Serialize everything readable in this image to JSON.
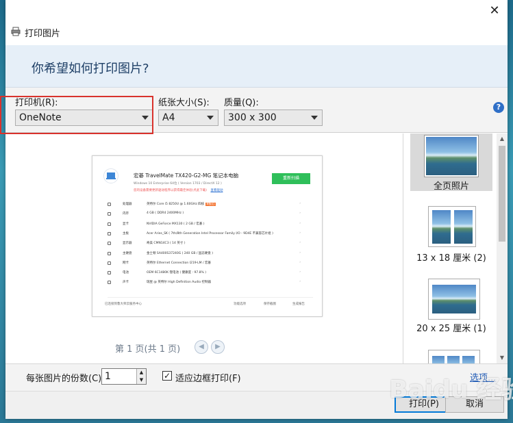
{
  "window": {
    "title": "打印图片",
    "close_glyph": "✕"
  },
  "banner": {
    "question": "你希望如何打印图片?"
  },
  "options": {
    "printer_label": "打印机(R):",
    "printer_value": "OneNote",
    "paper_label": "纸张大小(S):",
    "paper_value": "A4",
    "quality_label": "质量(Q):",
    "quality_value": "300 x 300",
    "help_glyph": "?"
  },
  "preview": {
    "page_info": "第 1 页(共 1 页)",
    "prev_glyph": "◀",
    "next_glyph": "▶",
    "document": {
      "title": "宏碁 TravelMate TX420-G2-MG 笔记本电脑",
      "subtitle": "Windows 10 Enterprise 64位 ( Version 1703 / DirectX 12 )",
      "warning": "您的设备需要更新驱动程序以获得最佳体验(点此下载)",
      "warning_link": "查看驱动",
      "scan_button": "重新扫描",
      "rows": [
        {
          "key": "处理器",
          "value": "英特尔 Core i5 8250U @ 1.60GHz 四核",
          "tag": "8核心"
        },
        {
          "key": "内存",
          "value": "4 GB ( DDR4 2400MHz )"
        },
        {
          "key": "显卡",
          "value": "NVIDIA GeForce MX130 ( 2 GB / 宏碁 )"
        },
        {
          "key": "主板",
          "value": "Acer Aries_SK ( 7th/8th Generation Intel Processor Family I/O - 9D4E 不兼容芯片组 )"
        },
        {
          "key": "显示器",
          "value": "奇美 CMN14C3 ( 14 英寸 )"
        },
        {
          "key": "主硬盘",
          "value": "金士顿 SA400S37240G ( 240 GB / 固态硬盘 )"
        },
        {
          "key": "网卡",
          "value": "英特尔 Ethernet Connection I219-LM / 宏碁"
        },
        {
          "key": "电池",
          "value": "OEM 6C1480K 锂电池 ( 健康度 : 97.8% )"
        },
        {
          "key": "声卡",
          "value": "瑞昱 @ 英特尔 High Definition Audio 控制器"
        }
      ],
      "footer_left": "已连接到鲁大师云服务中心",
      "footer_a": "功能选项",
      "footer_b": "保存截图",
      "footer_c": "生成报告"
    }
  },
  "layouts": [
    {
      "caption": "全页照片",
      "selected": true
    },
    {
      "caption": "13 x 18 厘米 (2)",
      "selected": false
    },
    {
      "caption": "20 x 25 厘米 (1)",
      "selected": false
    },
    {
      "caption": "",
      "selected": false
    }
  ],
  "copies": {
    "label": "每张图片的份数(C):",
    "value": "1"
  },
  "fit": {
    "label": "适应边框打印(F)",
    "checked": true,
    "check_glyph": "✓"
  },
  "options_link": "选项...",
  "buttons": {
    "print": "打印(P)",
    "cancel": "取消"
  },
  "watermark": "Baidu 经验"
}
